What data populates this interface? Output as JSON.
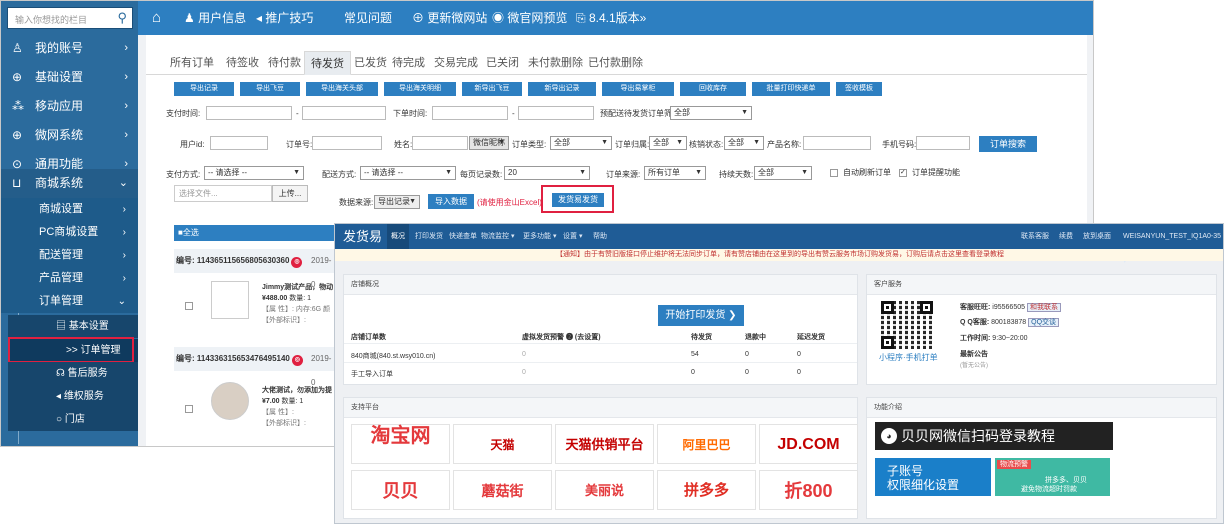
{
  "sidebar": {
    "search_placeholder": "输入你想找的栏目",
    "items": [
      {
        "label": "我的账号"
      },
      {
        "label": "基础设置"
      },
      {
        "label": "移动应用"
      },
      {
        "label": "微网系统"
      },
      {
        "label": "通用功能"
      },
      {
        "label": "商城系统"
      }
    ],
    "subitems": [
      {
        "label": "商城设置"
      },
      {
        "label": "PC商城设置"
      },
      {
        "label": "配送管理"
      },
      {
        "label": "产品管理"
      },
      {
        "label": "订单管理"
      }
    ],
    "third": [
      {
        "label": "基本设置"
      },
      {
        "label": ">> 订单管理"
      },
      {
        "label": "售后服务"
      },
      {
        "label": "维权服务"
      },
      {
        "label": "门店"
      }
    ]
  },
  "topnav": {
    "items": [
      "用户信息",
      "推广技巧",
      "常见问题",
      "更新微网站",
      "微官网预览",
      "8.4.1版本"
    ]
  },
  "tabs": [
    "所有订单",
    "待签收",
    "待付款",
    "待发货",
    "已发货",
    "待完成",
    "交易完成",
    "已关闭",
    "未付款删除",
    "已付款删除"
  ],
  "buttons": [
    "导出记录",
    "导出飞豆",
    "导出海关头部",
    "导出海关明细",
    "新导出飞豆",
    "新导出记录",
    "导出易掌柜",
    "回收库存",
    "批量打印快递单",
    "签收模板"
  ],
  "filters": {
    "pay_time": "支付时间:",
    "order_time": "下单时间:",
    "dash": "-",
    "preset_label": "预配送待发货订单筛选：",
    "preset_val": "全部",
    "userid": "用户id:",
    "order_no": "订单号:",
    "name": "姓名:",
    "nick": "微信昵称",
    "order_type": "订单类型:",
    "all": "全部",
    "belong": "订单归属:",
    "verify": "核销状态:",
    "product": "产品名称:",
    "phone": "手机号码:",
    "search": "订单搜索",
    "pay_method": "支付方式:",
    "choose": "-- 请选择 --",
    "ship_method": "配送方式:",
    "per_page": "每页记录数:",
    "per_page_val": "20",
    "source": "订单来源:",
    "source_val": "所有订单",
    "days": "持续天数:",
    "auto_refresh": "自动刷新订单",
    "remind": "订单提醒功能",
    "file_ph": "选择文件...",
    "upload": "上传...",
    "data_src": "数据来源:",
    "data_src_val": "导出记录",
    "import": "导入数据",
    "import_note": "(请使用金山Excel)",
    "fahuo": "发货易发货"
  },
  "orders": {
    "select_all": "■全选",
    "list": [
      {
        "no": "编号: 114365115656805630360",
        "date": "2019-0",
        "title": "Jimmy测试产品，物动",
        "price": "¥488.00",
        "qty": "数量: 1",
        "attr": "【属 性】: 内存:6G 颜",
        "mark": "【外部标识】:"
      },
      {
        "no": "编号: 114336315653476495140",
        "date": "2019-0",
        "title": "大佬测试，勿添加为提",
        "price": "¥7.00",
        "qty": "数量: 1",
        "attr": "【属 性】:",
        "mark": "【外部标识】:"
      }
    ]
  },
  "win2": {
    "brand": "发货易",
    "nav": [
      "概况",
      "打印发货",
      "快递查单",
      "物流监控 ▾",
      "更多功能 ▾",
      "设置 ▾",
      "帮助"
    ],
    "right": [
      "联系客服",
      "续费",
      "放到桌面",
      "WEISANYUN_TEST_IQ1A0-35 ▾"
    ],
    "notice": "【通知】由于有赞旧版接口停止维护将无法同步订单，请有赞店铺由在这里到的导出有赞云服务市场订购发货易，订购后请点击这里查看登录教程",
    "shop_title": "店铺概况",
    "print": "开始打印发货 ❯",
    "thead": [
      "店铺订单数",
      "虚拟发货预警 ❷ (去设置)",
      "待发货",
      "退款中",
      "延迟发货"
    ],
    "rows": [
      [
        "840商城(840.st.wsy010.cn)",
        "0",
        "54",
        "0",
        "0"
      ],
      [
        "手工导入订单",
        "0",
        "0",
        "0",
        "0"
      ]
    ],
    "platform_title": "支持平台",
    "platforms": [
      "淘宝网",
      "天猫 TMALL.COM",
      "天猫供销平台",
      "阿里巴巴",
      "JD.COM",
      "贝贝",
      "蘑菇街",
      "美丽说",
      "拼多多",
      "折800"
    ],
    "cs_title": "客户服务",
    "cs": {
      "ww_l": "客服旺旺:",
      "ww": "i95566505",
      "ww_btn": "和我联系",
      "qq_l": "Q Q客服:",
      "qq": "800183878",
      "qq_btn": "QQ交谈",
      "time_l": "工作时间:",
      "time": "9:30~20:00",
      "news_l": "最新公告",
      "news": "(暂无公告)",
      "qr_cap": "小程序·手机打单"
    },
    "func_title": "功能介绍",
    "wechat": "贝贝网微信扫码登录教程",
    "sub1": "子账号",
    "sub2": "权限细化设置",
    "warn_tag": "物流预警",
    "warn1": "拼多多、贝贝",
    "warn2": "避免物流超时罚款"
  }
}
